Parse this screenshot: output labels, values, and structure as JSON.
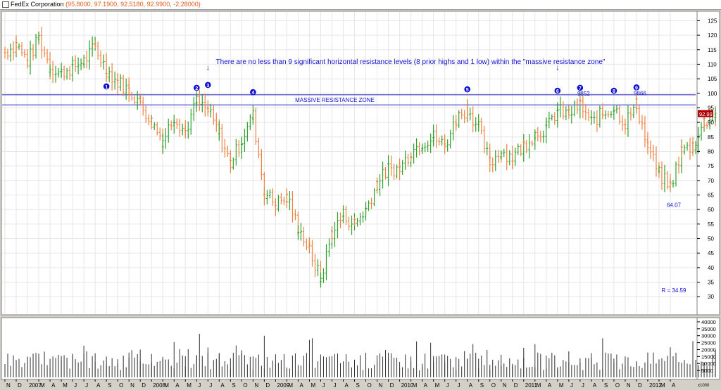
{
  "window": {
    "title": "FedEx Corporation",
    "quote": "(95.8000, 97.1900, 92.5180, 92.9900, -2.28000)"
  },
  "colors": {
    "up_bar": "#2ca02c",
    "down_bar": "#f08040",
    "resistance_line": "#2020c0",
    "annotation": "#1010d0",
    "last_price_bg": "#b00000",
    "volume_bar": "#303030"
  },
  "chart_data": [
    {
      "type": "ohlc",
      "title": "",
      "frequency": "weekly",
      "y_axis": {
        "ticks": [
          30,
          35,
          40,
          45,
          50,
          55,
          60,
          65,
          70,
          75,
          80,
          85,
          90,
          95,
          100,
          105,
          110,
          115,
          120,
          125
        ],
        "ylim": [
          24,
          128
        ]
      },
      "x_axis": {
        "ticks": [
          "N",
          "D",
          "2007",
          "M",
          "A",
          "M",
          "J",
          "J",
          "A",
          "S",
          "O",
          "N",
          "D",
          "2008",
          "M",
          "A",
          "M",
          "J",
          "J",
          "A",
          "S",
          "O",
          "N",
          "D",
          "2009",
          "M",
          "A",
          "M",
          "J",
          "J",
          "A",
          "S",
          "O",
          "N",
          "D",
          "2010",
          "M",
          "A",
          "M",
          "J",
          "J",
          "A",
          "S",
          "O",
          "N",
          "D",
          "2011",
          "M",
          "A",
          "M",
          "J",
          "J",
          "A",
          "S",
          "O",
          "N",
          "D",
          "2012",
          "M",
          "A"
        ]
      },
      "close_path": [
        {
          "date": "2006-11",
          "close": 114
        },
        {
          "date": "2006-12",
          "close": 117
        },
        {
          "date": "2007-01",
          "close": 111
        },
        {
          "date": "2007-02",
          "close": 119
        },
        {
          "date": "2007-03",
          "close": 109
        },
        {
          "date": "2007-04",
          "close": 107
        },
        {
          "date": "2007-05",
          "close": 109
        },
        {
          "date": "2007-06",
          "close": 111
        },
        {
          "date": "2007-07",
          "close": 116
        },
        {
          "date": "2007-08",
          "close": 108
        },
        {
          "date": "2007-09",
          "close": 104
        },
        {
          "date": "2007-10",
          "close": 101
        },
        {
          "date": "2007-11",
          "close": 97
        },
        {
          "date": "2007-12",
          "close": 90
        },
        {
          "date": "2008-01",
          "close": 84
        },
        {
          "date": "2008-02",
          "close": 92
        },
        {
          "date": "2008-03",
          "close": 87
        },
        {
          "date": "2008-04",
          "close": 97
        },
        {
          "date": "2008-05",
          "close": 94
        },
        {
          "date": "2008-06",
          "close": 86
        },
        {
          "date": "2008-07",
          "close": 76
        },
        {
          "date": "2008-08",
          "close": 84
        },
        {
          "date": "2008-09",
          "close": 92
        },
        {
          "date": "2008-10",
          "close": 66
        },
        {
          "date": "2008-11",
          "close": 62
        },
        {
          "date": "2008-12",
          "close": 64
        },
        {
          "date": "2009-01",
          "close": 54
        },
        {
          "date": "2009-02",
          "close": 46
        },
        {
          "date": "2009-03",
          "close": 36
        },
        {
          "date": "2009-04",
          "close": 52
        },
        {
          "date": "2009-05",
          "close": 58
        },
        {
          "date": "2009-06",
          "close": 55
        },
        {
          "date": "2009-07",
          "close": 60
        },
        {
          "date": "2009-08",
          "close": 69
        },
        {
          "date": "2009-09",
          "close": 74
        },
        {
          "date": "2009-10",
          "close": 74
        },
        {
          "date": "2009-11",
          "close": 80
        },
        {
          "date": "2009-12",
          "close": 83
        },
        {
          "date": "2010-01",
          "close": 85
        },
        {
          "date": "2010-02",
          "close": 82
        },
        {
          "date": "2010-03",
          "close": 91
        },
        {
          "date": "2010-04",
          "close": 95
        },
        {
          "date": "2010-05",
          "close": 88
        },
        {
          "date": "2010-06",
          "close": 76
        },
        {
          "date": "2010-07",
          "close": 80
        },
        {
          "date": "2010-08",
          "close": 78
        },
        {
          "date": "2010-09",
          "close": 82
        },
        {
          "date": "2010-10",
          "close": 86
        },
        {
          "date": "2010-11",
          "close": 88
        },
        {
          "date": "2010-12",
          "close": 94
        },
        {
          "date": "2011-01",
          "close": 93
        },
        {
          "date": "2011-02",
          "close": 96
        },
        {
          "date": "2011-03",
          "close": 90
        },
        {
          "date": "2011-04",
          "close": 93
        },
        {
          "date": "2011-05",
          "close": 95
        },
        {
          "date": "2011-06",
          "close": 90
        },
        {
          "date": "2011-07",
          "close": 96
        },
        {
          "date": "2011-08",
          "close": 82
        },
        {
          "date": "2011-09",
          "close": 72
        },
        {
          "date": "2011-10",
          "close": 68
        },
        {
          "date": "2011-11",
          "close": 80
        },
        {
          "date": "2011-12",
          "close": 82
        },
        {
          "date": "2012-01",
          "close": 90
        },
        {
          "date": "2012-02",
          "close": 93
        }
      ],
      "volume": {
        "unit_label": "x1000",
        "ticks": [
          5000,
          10000,
          15000,
          20000,
          25000,
          30000,
          35000,
          40000
        ],
        "ylim": [
          0,
          42000
        ]
      },
      "resistance_zone": {
        "label": "MASSIVE RESISTANCE ZONE",
        "upper": 99.5,
        "lower": 96
      },
      "last_price": "92.99",
      "annotation_text": "There are no less than 9 significant horizontal resistance levels (8 prior highs and 1 low) within the \"massive resistance zone\"",
      "markers": [
        {
          "n": "1",
          "date": "2007-08",
          "price": 99
        },
        {
          "n": "2",
          "date": "2008-04",
          "price": 98.5
        },
        {
          "n": "3",
          "date": "2008-05",
          "price": 99.5
        },
        {
          "n": "4",
          "date": "2008-09",
          "price": 97
        },
        {
          "n": "5",
          "date": "2010-04",
          "price": 98
        },
        {
          "n": "6",
          "date": "2010-12",
          "price": 97.5
        },
        {
          "n": "7",
          "date": "2011-02",
          "price": 98.52
        },
        {
          "n": "8",
          "date": "2011-05",
          "price": 97.5
        },
        {
          "n": "9",
          "date": "2011-07",
          "price": 98.66
        }
      ],
      "arrow_marks": [
        "2008-05",
        "2010-12"
      ],
      "price_labels": [
        {
          "text": "9852",
          "date": "2011-02",
          "price": 98.52
        },
        {
          "text": "9866",
          "date": "2011-07",
          "price": 98.66
        },
        {
          "text": "64.07",
          "date": "2011-10",
          "price": 64.07
        },
        {
          "text": "R = 34.59",
          "date": "2011-10",
          "price": 34.59
        }
      ]
    }
  ]
}
